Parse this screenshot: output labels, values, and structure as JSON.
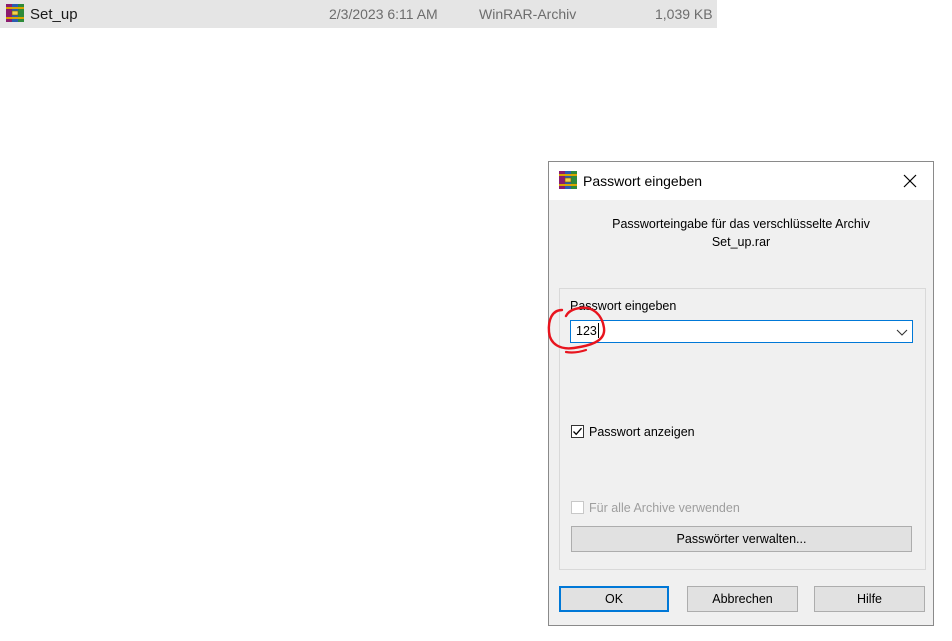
{
  "file": {
    "name": "Set_up",
    "date": "2/3/2023 6:11 AM",
    "type": "WinRAR-Archiv",
    "size": "1,039 KB"
  },
  "dialog": {
    "title": "Passwort eingeben",
    "message_line1": "Passworteingabe für das verschlüsselte Archiv",
    "message_line2": "Set_up.rar",
    "password_label": "Passwort eingeben",
    "password_value": "123",
    "show_password_label": "Passwort anzeigen",
    "show_password_checked": true,
    "use_for_all_label": "Für alle Archive verwenden",
    "use_for_all_checked": false,
    "use_for_all_enabled": false,
    "manage_button": "Passwörter verwalten...",
    "ok_button": "OK",
    "cancel_button": "Abbrechen",
    "help_button": "Hilfe"
  },
  "colors": {
    "focus_accent": "#0078d7",
    "annotation": "#e8141e"
  }
}
